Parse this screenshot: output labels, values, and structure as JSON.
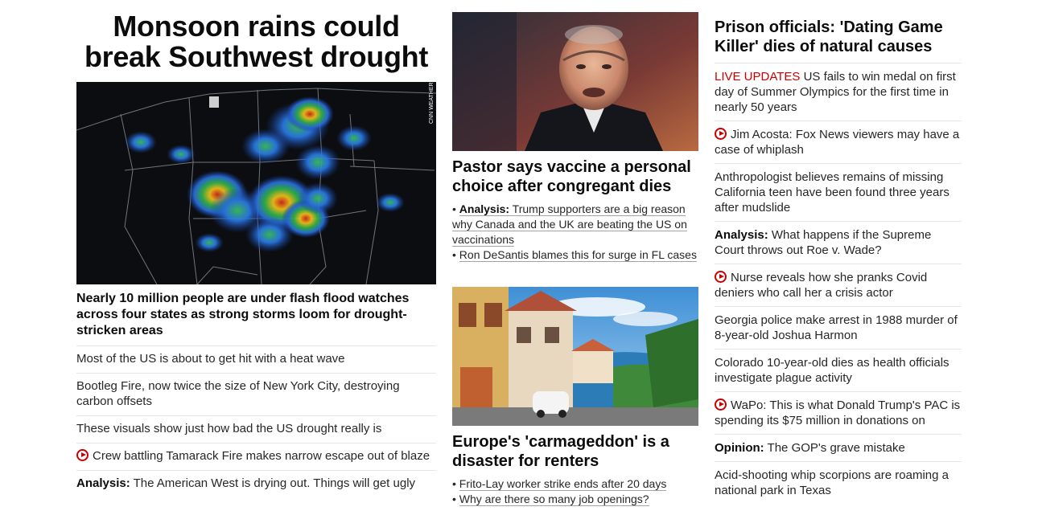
{
  "left": {
    "headline": "Monsoon rains could break Southwest drought",
    "image_credit": "CNN WEATHER",
    "subheadline": "Nearly 10 million people are under flash flood watches across four states as strong storms loom for drought-stricken areas",
    "items": [
      {
        "prefix": "",
        "text": "Most of the US is about to get hit with a heat wave"
      },
      {
        "prefix": "",
        "text": "Bootleg Fire, now twice the size of New York City, destroying carbon offsets"
      },
      {
        "prefix": "",
        "text": "These visuals show just how bad the US drought really is"
      },
      {
        "prefix": "",
        "text": "Crew battling Tamarack Fire makes narrow escape out of blaze",
        "icon": "play-icon"
      },
      {
        "prefix": "Analysis:",
        "text": " The American West is drying out. Things will get ugly"
      }
    ]
  },
  "middle": {
    "story1": {
      "headline": "Pastor says vaccine a personal choice after congregant dies",
      "bullets": [
        {
          "prefix": "Analysis:",
          "text": " Trump supporters are a big reason why Canada and the UK are beating the US on vaccinations"
        },
        {
          "prefix": "",
          "text": "Ron DeSantis blames this for surge in FL cases"
        }
      ]
    },
    "story2": {
      "headline": "Europe's 'carmageddon' is a disaster for renters",
      "bullets": [
        {
          "prefix": "",
          "text": "Frito-Lay worker strike ends after 20 days"
        },
        {
          "prefix": "",
          "text": "Why are there so many job openings?"
        }
      ]
    }
  },
  "right": {
    "headline": "Prison officials: 'Dating Game Killer' dies of natural causes",
    "items": [
      {
        "live": "LIVE UPDATES",
        "text": " US fails to win medal on first day of Summer Olympics for the first time in nearly 50 years"
      },
      {
        "text": "Jim Acosta: Fox News viewers may have a case of whiplash",
        "icon": "play-icon"
      },
      {
        "text": "Anthropologist believes remains of missing California teen have been found three years after mudslide"
      },
      {
        "prefix": "Analysis:",
        "text": " What happens if the Supreme Court throws out Roe v. Wade?"
      },
      {
        "text": "Nurse reveals how she pranks Covid deniers who call her a crisis actor",
        "icon": "play-icon"
      },
      {
        "text": "Georgia police make arrest in 1988 murder of 8-year-old Joshua Harmon"
      },
      {
        "text": "Colorado 10-year-old dies as health officials investigate plague activity"
      },
      {
        "text": "WaPo: This is what Donald Trump's PAC is spending its $75 million in donations on",
        "icon": "play-icon"
      },
      {
        "prefix": "Opinion:",
        "text": " The GOP's grave mistake"
      },
      {
        "text": "Acid-shooting whip scorpions are roaming a national park in Texas"
      }
    ]
  },
  "colors": {
    "accent": "#cc0000",
    "text": "#262626",
    "divider": "#e6e6e6"
  }
}
